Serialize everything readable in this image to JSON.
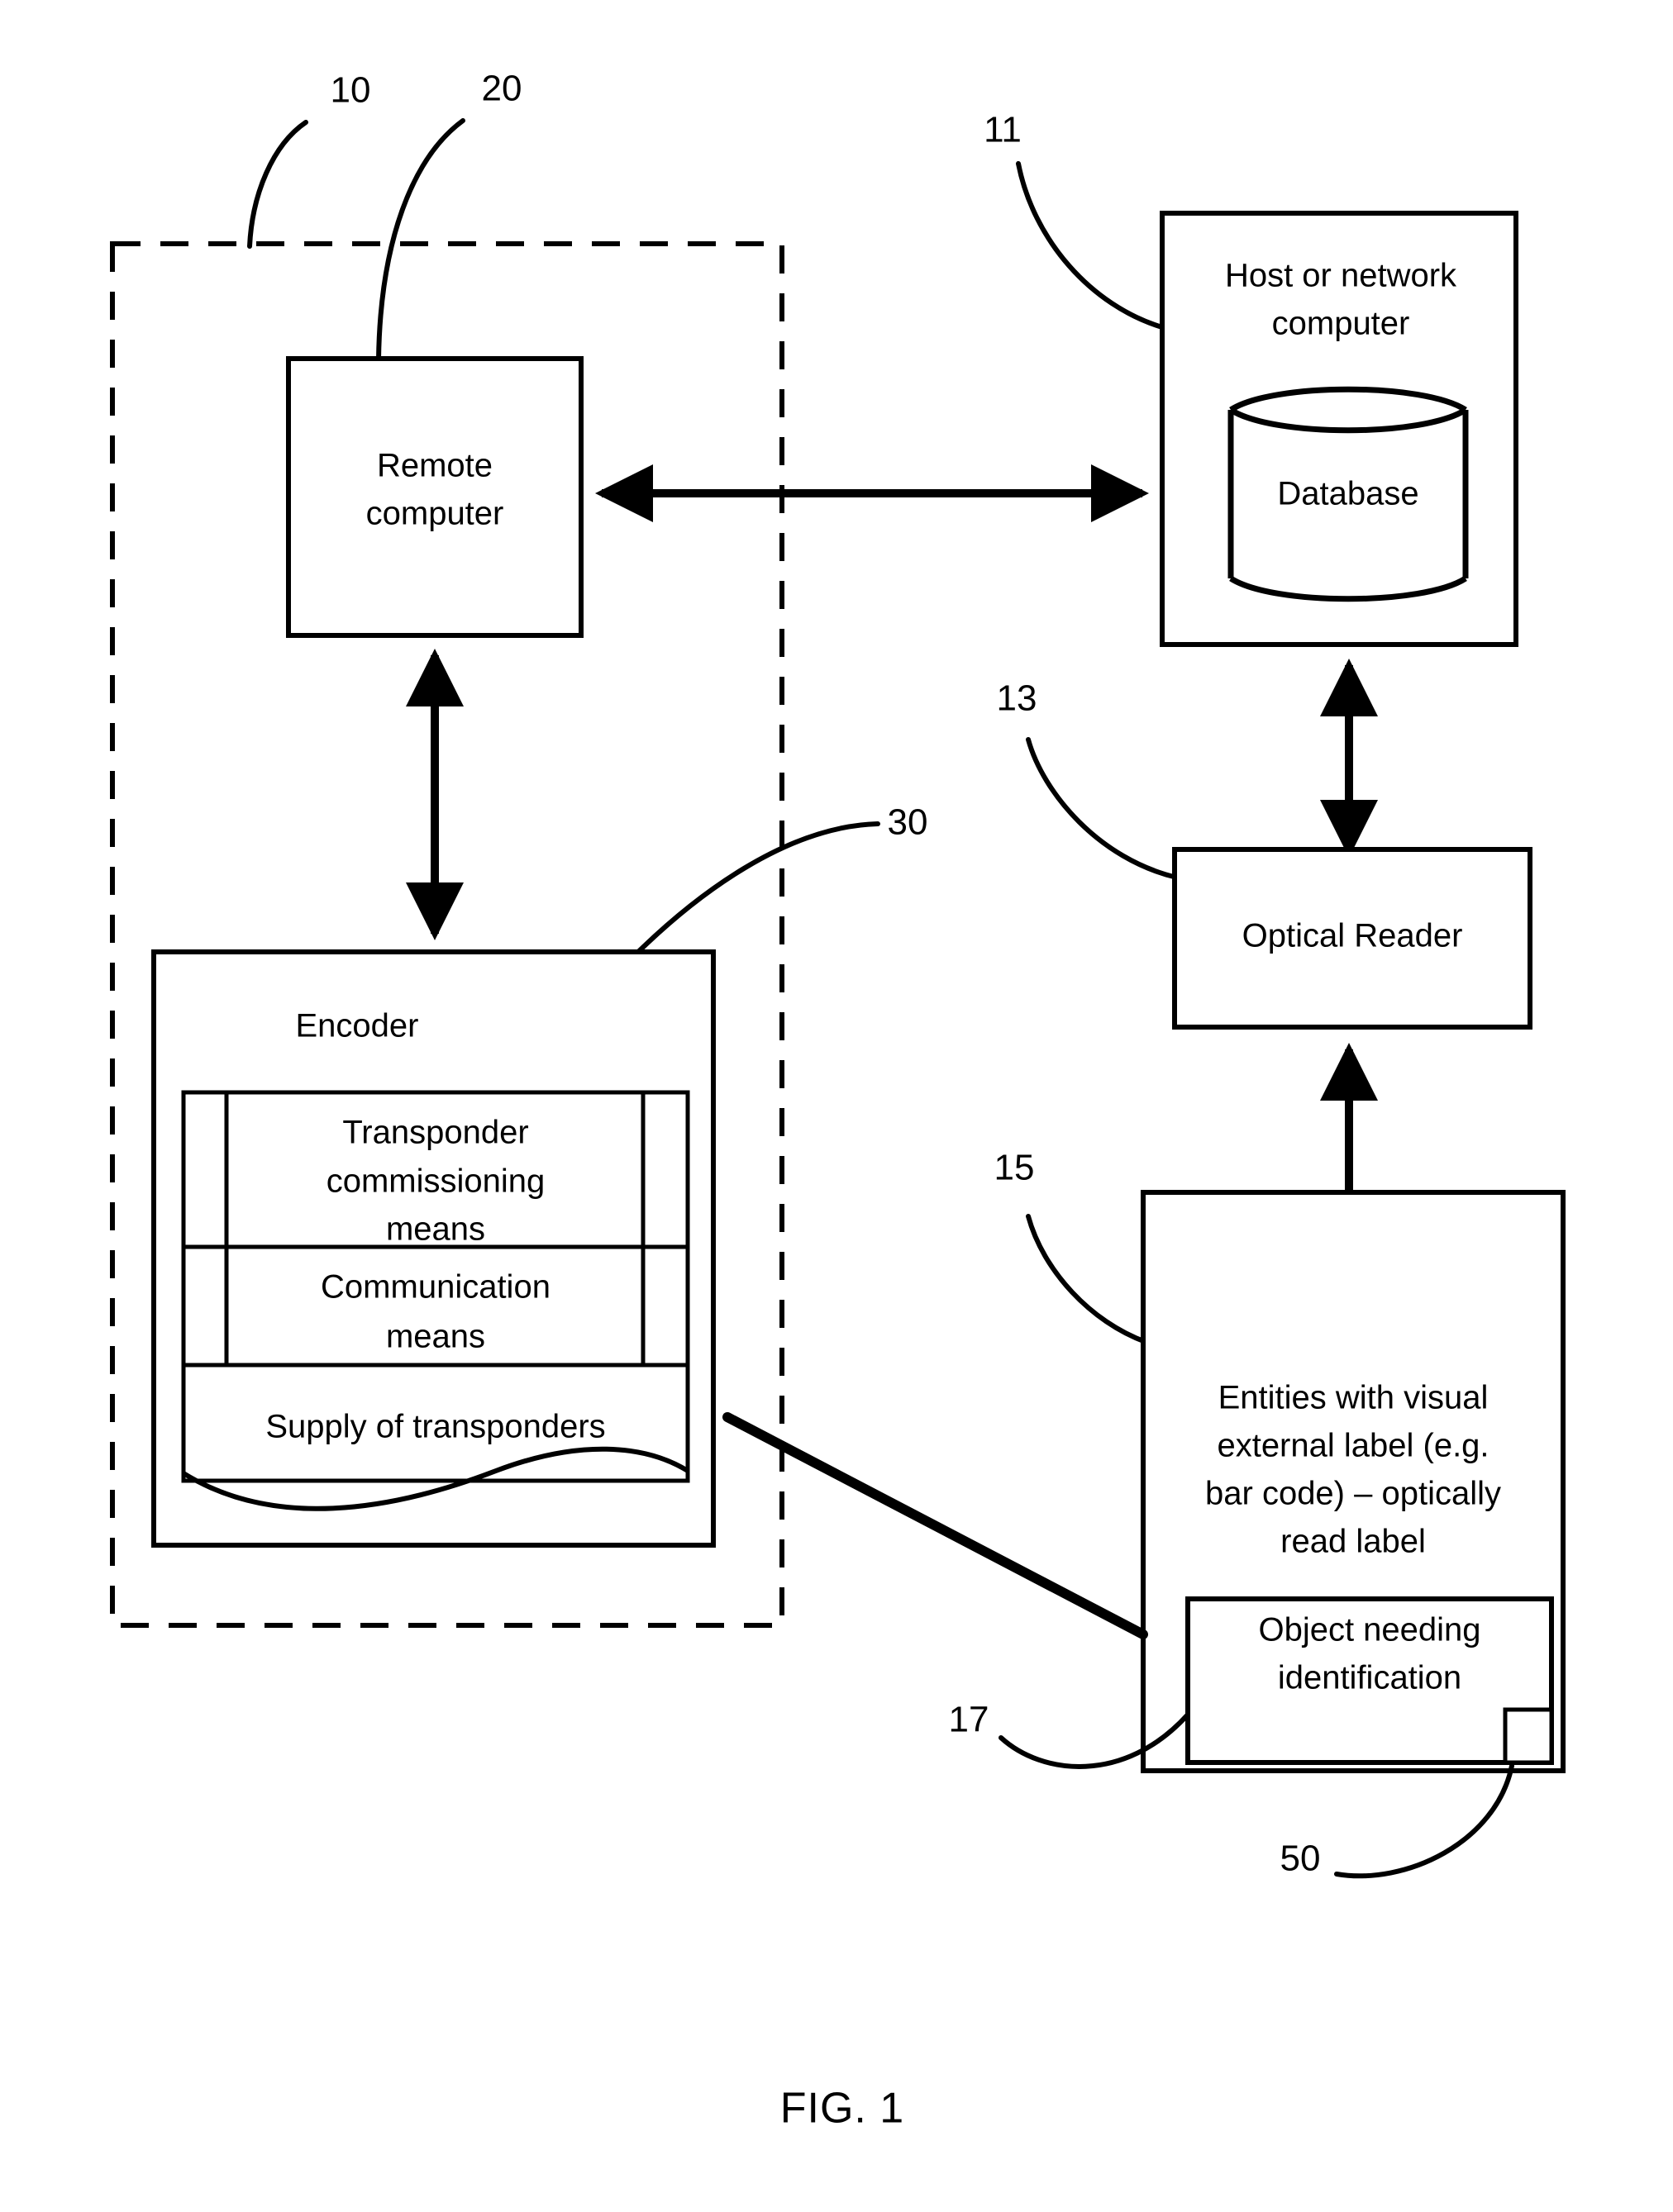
{
  "figure": {
    "caption": "FIG. 1",
    "type": "patent-block-diagram"
  },
  "reference_numerals": {
    "system_boundary": "10",
    "remote_computer": "20",
    "host_computer": "11",
    "encoder": "30",
    "optical_reader": "13",
    "entities": "15",
    "object": "17",
    "transponder": "50"
  },
  "blocks": {
    "remote_computer": {
      "line1": "Remote",
      "line2": "computer"
    },
    "host_computer": {
      "line1": "Host or network",
      "line2": "computer",
      "database_label": "Database"
    },
    "optical_reader": {
      "label": "Optical Reader"
    },
    "encoder": {
      "title": "Encoder",
      "compartments": [
        {
          "line1": "Transponder",
          "line2": "commissioning",
          "line3": "means"
        },
        {
          "line1": "Communication",
          "line2": "means"
        },
        {
          "line1": "Supply of transponders"
        }
      ]
    },
    "entities": {
      "line1": "Entities with visual",
      "line2": "external label (e.g.",
      "line3": "bar code) – optically",
      "line4": "read label",
      "object": {
        "line1": "Object needing",
        "line2": "identification"
      }
    }
  },
  "colors": {
    "stroke": "#000000",
    "fill": "#ffffff"
  }
}
